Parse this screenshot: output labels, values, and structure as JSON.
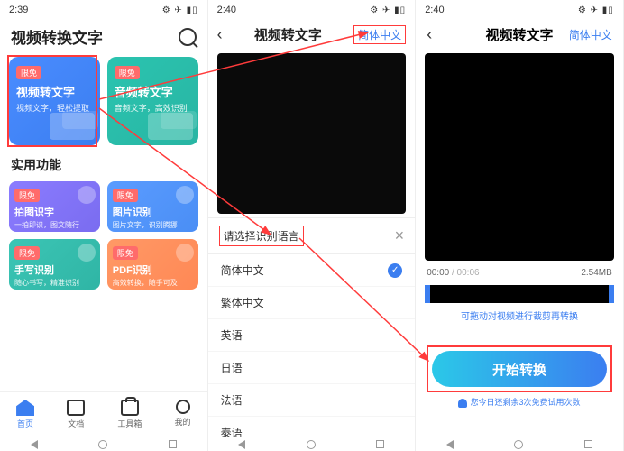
{
  "screen1": {
    "status_time": "2:39",
    "title": "视频转换文字",
    "card1": {
      "badge": "限免",
      "title": "视频转文字",
      "sub": "视频文字，轻松提取"
    },
    "card2": {
      "badge": "限免",
      "title": "音频转文字",
      "sub": "音频文字，高效识别"
    },
    "section": "实用功能",
    "sc1": {
      "badge": "限免",
      "title": "拍图识字",
      "sub": "一拍即识，图文随行"
    },
    "sc2": {
      "badge": "限免",
      "title": "图片识别",
      "sub": "图片文字，识别腾挪"
    },
    "sc3": {
      "badge": "限免",
      "title": "手写识别",
      "sub": "随心书写，精准识别"
    },
    "sc4": {
      "badge": "限免",
      "title": "PDF识别",
      "sub": "高效转换，随手可及"
    },
    "tabs": {
      "home": "首页",
      "doc": "文档",
      "tool": "工具箱",
      "mine": "我的"
    }
  },
  "screen2": {
    "status_time": "2:40",
    "title": "视频转文字",
    "lang_link": "简体中文",
    "sheet_title": "请选择识别语言",
    "langs": [
      "简体中文",
      "繁体中文",
      "英语",
      "日语",
      "法语",
      "泰语"
    ]
  },
  "screen3": {
    "status_time": "2:40",
    "title": "视频转文字",
    "lang_link": "简体中文",
    "time_cur": "00:00",
    "time_total": "/ 00:06",
    "size": "2.54MB",
    "hint": "可拖动对视频进行裁剪再转换",
    "start_btn": "开始转换",
    "remaining": "您今日还剩余3次免费试用次数"
  }
}
